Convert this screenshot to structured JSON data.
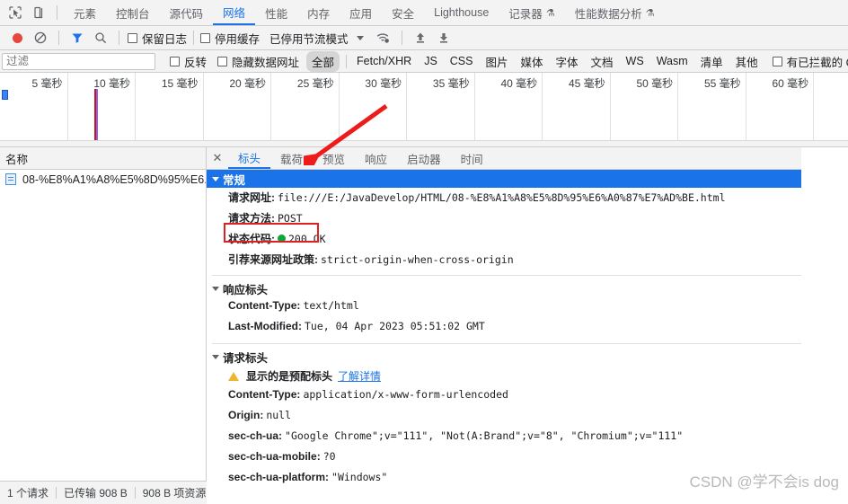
{
  "main_tabs": {
    "inspect_icon": "inspect-cursor-icon",
    "device_icon": "device-toolbar-icon",
    "items": [
      {
        "label": "元素",
        "active": false,
        "flask": false
      },
      {
        "label": "控制台",
        "active": false,
        "flask": false
      },
      {
        "label": "源代码",
        "active": false,
        "flask": false
      },
      {
        "label": "网络",
        "active": true,
        "flask": false
      },
      {
        "label": "性能",
        "active": false,
        "flask": false
      },
      {
        "label": "内存",
        "active": false,
        "flask": false
      },
      {
        "label": "应用",
        "active": false,
        "flask": false
      },
      {
        "label": "安全",
        "active": false,
        "flask": false
      },
      {
        "label": "Lighthouse",
        "active": false,
        "flask": false
      },
      {
        "label": "记录器",
        "active": false,
        "flask": true
      },
      {
        "label": "性能数据分析",
        "active": false,
        "flask": true
      }
    ],
    "flask_glyph": "⚗"
  },
  "net_toolbar": {
    "record_title": "record-button",
    "clear_glyph": "⃠",
    "filter_glyph": "filter-icon",
    "search_glyph": "search-icon",
    "preserve_log": "保留日志",
    "disable_cache": "停用缓存",
    "throttling": "已停用节流模式",
    "wifi_glyph": "wifi-settings-icon",
    "import_glyph": "↑",
    "export_glyph": "↓"
  },
  "filter_bar": {
    "placeholder": "过滤",
    "value": "",
    "invert": "反转",
    "hide_data_urls": "隐藏数据网址",
    "types": [
      {
        "label": "全部",
        "selected": true
      },
      {
        "label": "Fetch/XHR",
        "selected": false
      },
      {
        "label": "JS",
        "selected": false
      },
      {
        "label": "CSS",
        "selected": false
      },
      {
        "label": "图片",
        "selected": false
      },
      {
        "label": "媒体",
        "selected": false
      },
      {
        "label": "字体",
        "selected": false
      },
      {
        "label": "文档",
        "selected": false
      },
      {
        "label": "WS",
        "selected": false
      },
      {
        "label": "Wasm",
        "selected": false
      },
      {
        "label": "清单",
        "selected": false
      },
      {
        "label": "其他",
        "selected": false
      }
    ],
    "blocked_cookies": "有已拦截的 C"
  },
  "overview": {
    "ticks": [
      "5 毫秒",
      "10 毫秒",
      "15 毫秒",
      "20 毫秒",
      "25 毫秒",
      "30 毫秒",
      "35 毫秒",
      "40 毫秒",
      "45 毫秒",
      "50 毫秒",
      "55 毫秒",
      "60 毫秒"
    ]
  },
  "requests": {
    "column_header": "名称",
    "items": [
      {
        "name": "08-%E8%A1%A8%E5%8D%95%E6...",
        "icon": "document-icon",
        "selected": true
      }
    ]
  },
  "detail": {
    "close_glyph": "✕",
    "tabs": [
      {
        "label": "标头",
        "active": true
      },
      {
        "label": "载荷",
        "active": false
      },
      {
        "label": "预览",
        "active": false
      },
      {
        "label": "响应",
        "active": false
      },
      {
        "label": "启动器",
        "active": false
      },
      {
        "label": "时间",
        "active": false
      }
    ],
    "general": {
      "title": "常规",
      "rows": [
        {
          "name": "请求网址:",
          "value": "file:///E:/JavaDevelop/HTML/08-%E8%A1%A8%E5%8D%95%E6%A0%87%E7%AD%BE.html",
          "status": false
        },
        {
          "name": "请求方法:",
          "value": "POST",
          "status": false
        },
        {
          "name": "状态代码:",
          "value": "200 OK",
          "status": true
        },
        {
          "name": "引荐来源网址政策:",
          "value": "strict-origin-when-cross-origin",
          "status": false
        }
      ]
    },
    "response_headers": {
      "title": "响应标头",
      "rows": [
        {
          "name": "Content-Type:",
          "value": "text/html"
        },
        {
          "name": "Last-Modified:",
          "value": "Tue, 04 Apr 2023 05:51:02 GMT"
        }
      ]
    },
    "request_headers": {
      "title": "请求标头",
      "warning_text": "显示的是预配标头",
      "warning_link": "了解详情",
      "rows": [
        {
          "name": "Content-Type:",
          "value": "application/x-www-form-urlencoded"
        },
        {
          "name": "Origin:",
          "value": "null"
        },
        {
          "name": "sec-ch-ua:",
          "value": "\"Google Chrome\";v=\"111\", \"Not(A:Brand\";v=\"8\", \"Chromium\";v=\"111\""
        },
        {
          "name": "sec-ch-ua-mobile:",
          "value": "?0"
        },
        {
          "name": "sec-ch-ua-platform:",
          "value": "\"Windows\""
        }
      ]
    }
  },
  "status_bar": {
    "requests": "1 个请求",
    "transferred": "已传输 908 B",
    "resources": "908 B 项资源"
  },
  "watermark": "CSDN @学不会is dog",
  "colors": {
    "accent": "#1a73e8",
    "record": "#e8453c",
    "annotation": "#e02020",
    "status_ok": "#0ea539",
    "warning": "#f0b429"
  }
}
